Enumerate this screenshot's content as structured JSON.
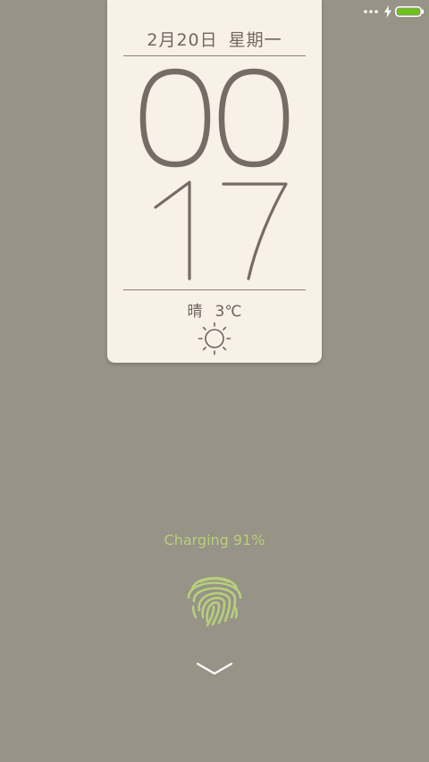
{
  "status_bar": {
    "battery_level": 1.0,
    "charging": true,
    "battery_color": "#6ac21b"
  },
  "lock_clock": {
    "date": "2月20日",
    "weekday": "星期一",
    "hour": "00",
    "minute": "17",
    "weather": {
      "condition": "晴",
      "temperature": "3℃",
      "icon": "sun-icon"
    }
  },
  "charging": {
    "text": "Charging 91%"
  },
  "unlock": {
    "icon": "fingerprint-icon",
    "swipe_icon": "chevron-down-icon"
  },
  "colors": {
    "background": "#979387",
    "card": "#f8f1e8",
    "digit": "#766c65",
    "accent_green": "#b7cf7b"
  }
}
